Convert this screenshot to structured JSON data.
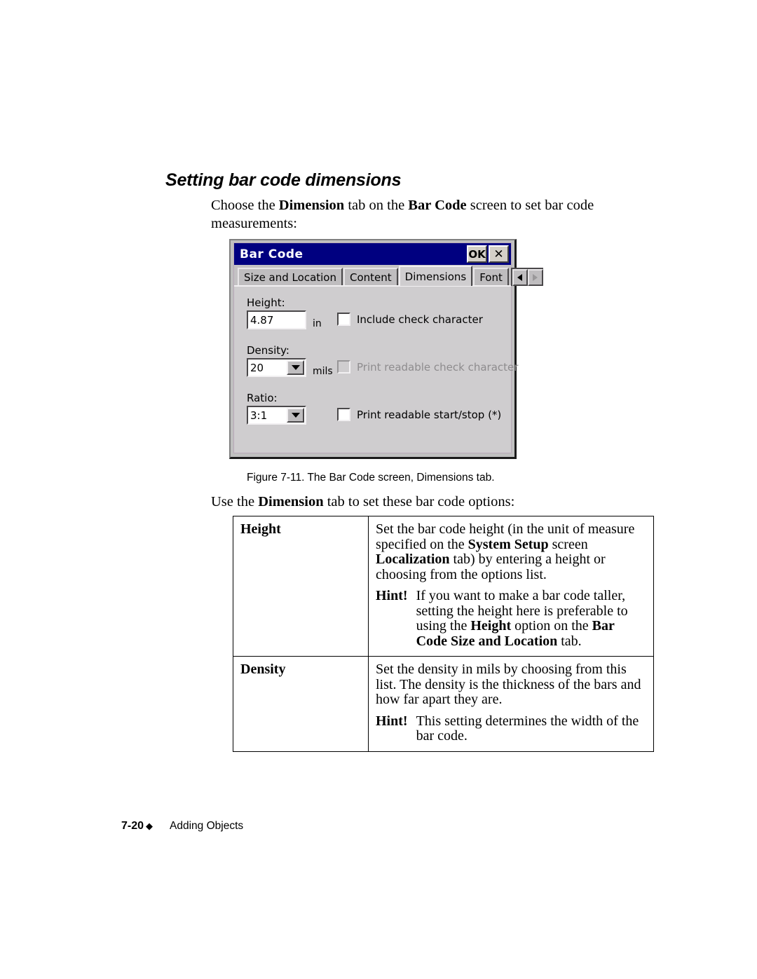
{
  "page": {
    "heading": "Setting bar code dimensions",
    "intro": {
      "part1": "Choose the ",
      "bold1": "Dimension",
      "part2": " tab on the ",
      "bold2": "Bar Code",
      "part3": " screen to set bar code measurements:"
    },
    "figure_caption": "Figure 7-11. The Bar Code screen, Dimensions tab.",
    "use_line": {
      "part1": "Use the ",
      "bold1": "Dimension",
      "part2": " tab to set these bar code options:"
    },
    "footer": {
      "page_number": "7-20",
      "diamond": "◆",
      "section": "Adding Objects"
    }
  },
  "dialog": {
    "title": "Bar Code",
    "titlebar_buttons": {
      "ok": "OK",
      "close": "✕"
    },
    "tabs": [
      {
        "label": "Size and Location",
        "active": false
      },
      {
        "label": "Content",
        "active": false
      },
      {
        "label": "Dimensions",
        "active": true
      },
      {
        "label": "Font",
        "active": false
      }
    ],
    "tab_scroll": {
      "left": "◀",
      "right": "▶"
    },
    "fields": {
      "height": {
        "label": "Height:",
        "value": "4.87",
        "unit": "in"
      },
      "density": {
        "label": "Density:",
        "value": "20",
        "unit": "mils"
      },
      "ratio": {
        "label": "Ratio:",
        "value": "3:1",
        "unit": ""
      }
    },
    "checkboxes": [
      {
        "label": "Include check character",
        "checked": false,
        "disabled": false
      },
      {
        "label": "Print readable check character",
        "checked": false,
        "disabled": true
      },
      {
        "label": "Print readable start/stop (*)",
        "checked": false,
        "disabled": false
      }
    ],
    "colors": {
      "titlebar": "#000080",
      "face": "#cfcdcf",
      "frame": "#c0c0c0"
    }
  },
  "options_table": {
    "rows": [
      {
        "term": "Height",
        "desc": {
          "p1_a": "Set the bar code height (in the unit of measure specified on the ",
          "p1_b1": "System Setup",
          "p1_c": " screen ",
          "p1_b2": "Localization",
          "p1_d": " tab) by entering a height or choosing from the options list.",
          "hint_word": "Hint!",
          "hint_a": "If you want to make a bar code taller, setting the height here is preferable to using the ",
          "hint_b1": "Height",
          "hint_c": " option on the ",
          "hint_b2": "Bar Code Size and Location",
          "hint_d": " tab."
        }
      },
      {
        "term": "Density",
        "desc": {
          "p1_a": "Set the density in mils by choosing from this list. The density is the thickness of the bars and how far apart they are.",
          "p1_b1": "",
          "p1_c": "",
          "p1_b2": "",
          "p1_d": "",
          "hint_word": "Hint!",
          "hint_a": "This setting determines the width of the bar code.",
          "hint_b1": "",
          "hint_c": "",
          "hint_b2": "",
          "hint_d": ""
        }
      }
    ]
  }
}
